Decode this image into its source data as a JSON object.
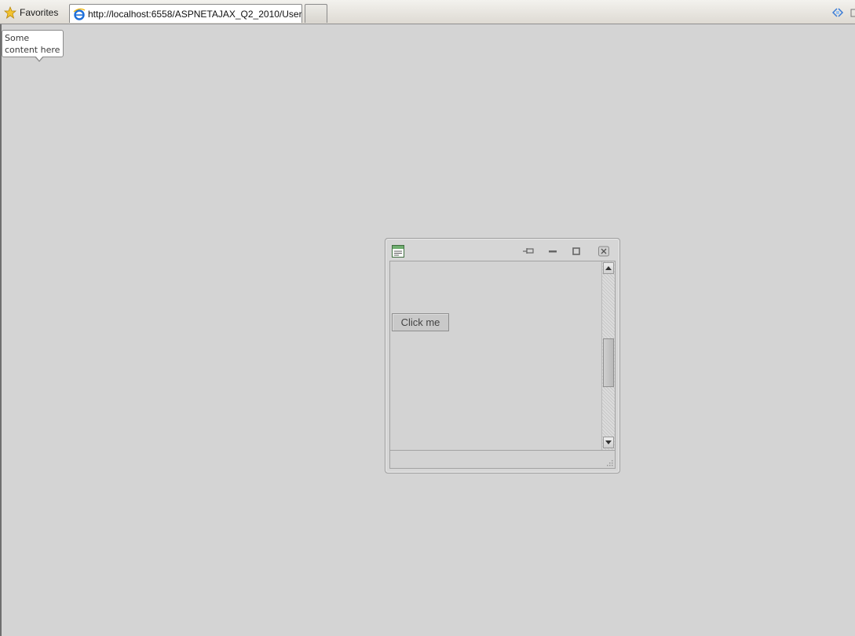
{
  "browser": {
    "favorites_label": "Favorites",
    "tab_title": "http://localhost:6558/ASPNETAJAX_Q2_2010/UserCo...",
    "icons": {
      "favorites": "star-icon",
      "tab": "ie-icon",
      "suggested_sites": "suggested-sites-icon"
    }
  },
  "tooltip": {
    "text": "Some content here"
  },
  "window": {
    "icons": {
      "title": "window-icon",
      "pin": "pin-icon",
      "minimize": "minimize-icon",
      "maximize": "maximize-icon",
      "close": "close-icon"
    },
    "content": {
      "button_label": "Click me"
    }
  },
  "colors": {
    "page_background": "#d4d4d4",
    "window_background": "#d6d6d6",
    "tooltip_background": "#ffffff"
  }
}
